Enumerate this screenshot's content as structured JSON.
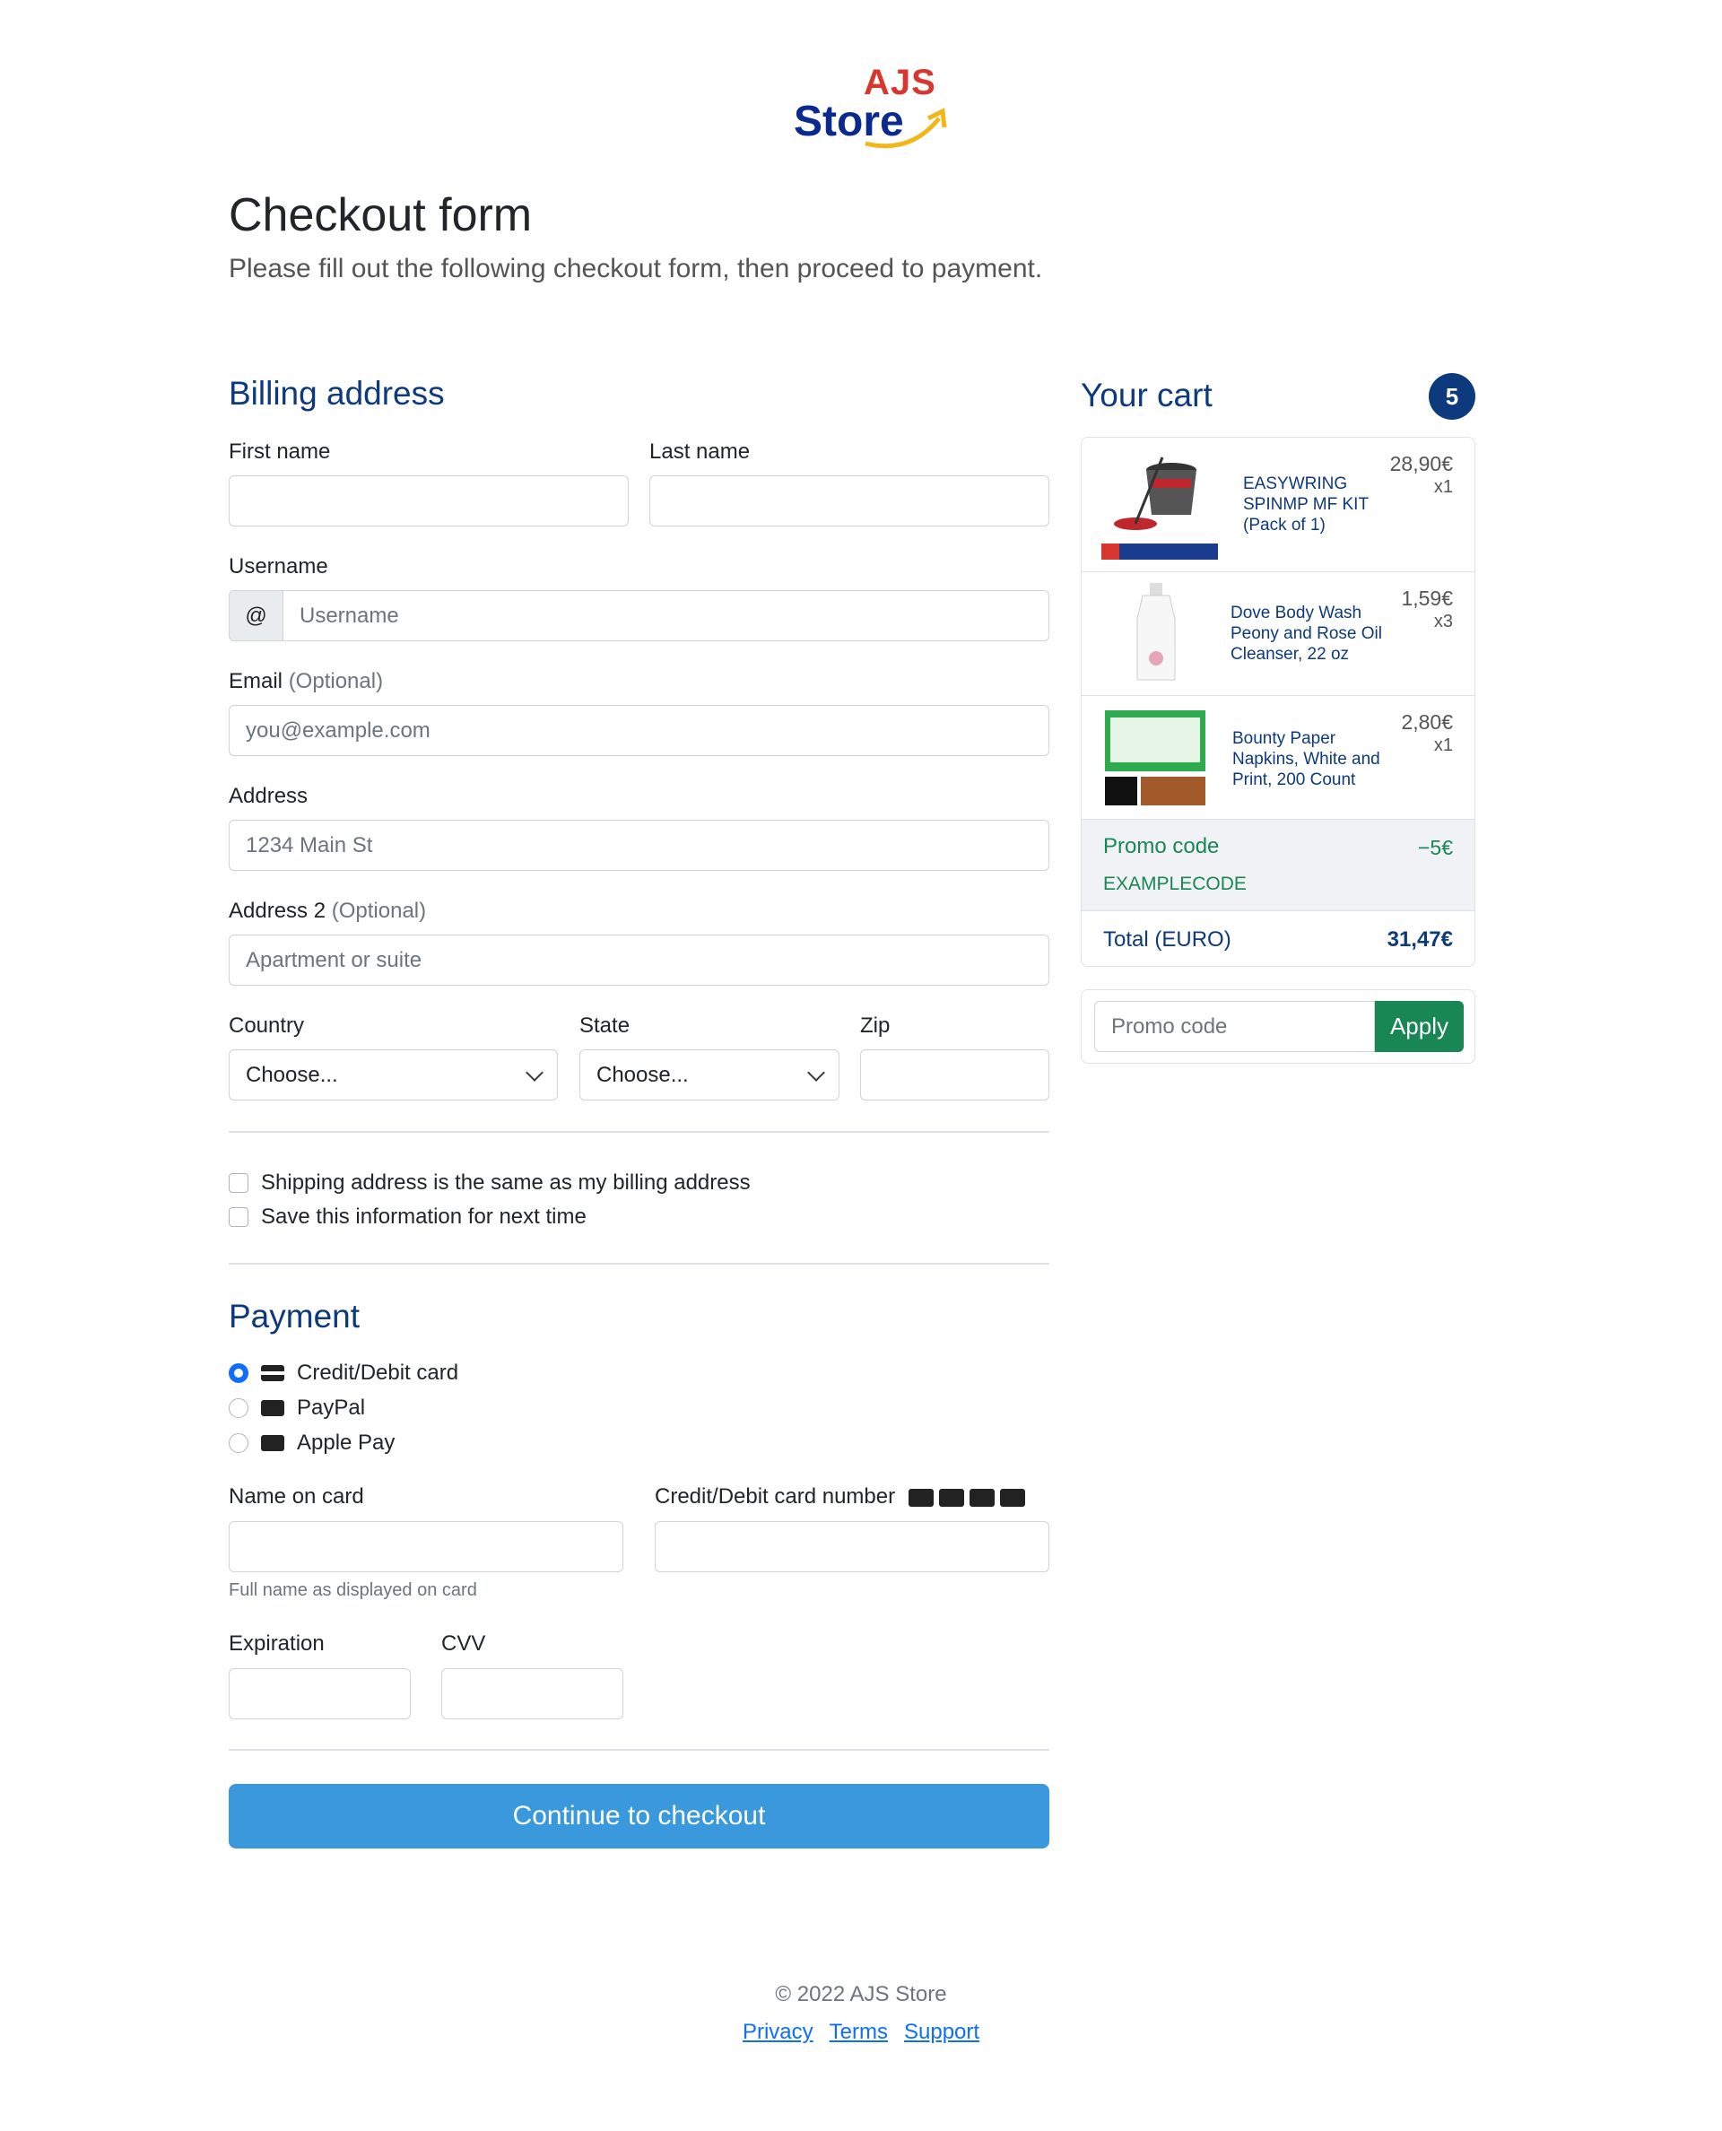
{
  "brand": {
    "line1": "AJS",
    "line2": "Store"
  },
  "header": {
    "title": "Checkout form",
    "lead": "Please fill out the following checkout form, then proceed to payment."
  },
  "billing": {
    "heading": "Billing address",
    "first_name_label": "First name",
    "last_name_label": "Last name",
    "username_label": "Username",
    "username_addon": "@",
    "username_placeholder": "Username",
    "email_label": "Email",
    "email_optional": "(Optional)",
    "email_placeholder": "you@example.com",
    "address_label": "Address",
    "address_placeholder": "1234 Main St",
    "address2_label": "Address 2",
    "address2_optional": "(Optional)",
    "address2_placeholder": "Apartment or suite",
    "country_label": "Country",
    "country_value": "Choose...",
    "state_label": "State",
    "state_value": "Choose...",
    "zip_label": "Zip"
  },
  "options": {
    "same_address": "Shipping address is the same as my billing address",
    "save_info": "Save this information for next time"
  },
  "payment": {
    "heading": "Payment",
    "methods": [
      {
        "label": "Credit/Debit card",
        "selected": true,
        "icon": "credit-card-icon"
      },
      {
        "label": "PayPal",
        "selected": false,
        "icon": "paypal-icon"
      },
      {
        "label": "Apple Pay",
        "selected": false,
        "icon": "apple-pay-icon"
      }
    ],
    "name_on_card_label": "Name on card",
    "name_on_card_help": "Full name as displayed on card",
    "card_number_label": "Credit/Debit card number",
    "expiration_label": "Expiration",
    "cvv_label": "CVV",
    "submit_label": "Continue to checkout"
  },
  "cart": {
    "heading": "Your cart",
    "count": "5",
    "items": [
      {
        "name": "EASYWRING SPINMP MF KIT (Pack of 1)",
        "price": "28,90€",
        "qty": "x1"
      },
      {
        "name": "Dove Body Wash Peony and Rose Oil Cleanser, 22 oz",
        "price": "1,59€",
        "qty": "x3"
      },
      {
        "name": "Bounty Paper Napkins, White and Print, 200 Count",
        "price": "2,80€",
        "qty": "x1"
      }
    ],
    "promo_title": "Promo code",
    "promo_code": "EXAMPLECODE",
    "promo_amount": "−5€",
    "total_label": "Total (EURO)",
    "total_value": "31,47€",
    "promo_placeholder": "Promo code",
    "apply_label": "Apply"
  },
  "footer": {
    "copyright": "© 2022 AJS Store",
    "links": [
      "Privacy",
      "Terms",
      "Support"
    ]
  },
  "colors": {
    "accent": "#0d3a7d",
    "primary_button": "#3a98dc",
    "success": "#198754"
  }
}
